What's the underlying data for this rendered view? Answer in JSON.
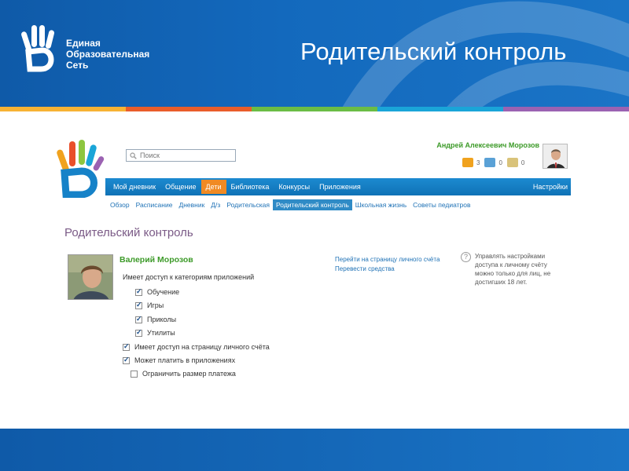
{
  "brand": {
    "logo_line1": "Единая",
    "logo_line2": "Образовательная",
    "logo_line3": "Сеть"
  },
  "slide_title": "Родительский контроль",
  "colors": {
    "banner": "#1369bd",
    "accent_orange": "#f08a24",
    "nav_blue": "#1682c8",
    "green_text": "#3c9a28",
    "stripe": [
      "#f7b234",
      "#e95d2a",
      "#6bbd45",
      "#1aa5d8",
      "#9b62b2"
    ]
  },
  "search": {
    "placeholder": "Поиск"
  },
  "user": {
    "name": "Андрей Алексеевич Морозов",
    "counters": [
      {
        "icon": "mail-icon",
        "value": "3"
      },
      {
        "icon": "friends-icon",
        "value": "0"
      },
      {
        "icon": "requests-icon",
        "value": "0"
      }
    ]
  },
  "nav": {
    "items": [
      "Мой дневник",
      "Общение",
      "Дети",
      "Библиотека",
      "Конкурсы",
      "Приложения"
    ],
    "active": "Дети",
    "settings": "Настройки"
  },
  "subnav": {
    "items": [
      "Обзор",
      "Расписание",
      "Дневник",
      "Д/з",
      "Родительская",
      "Родительский контроль",
      "Школьная жизнь",
      "Советы педиатров"
    ],
    "active": "Родительский контроль"
  },
  "page_title": "Родительский контроль",
  "child": {
    "name": "Валерий Морозов",
    "permissions_heading": "Имеет доступ к категориям приложений",
    "categories": [
      {
        "label": "Обучение",
        "checked": true
      },
      {
        "label": "Игры",
        "checked": true
      },
      {
        "label": "Приколы",
        "checked": true
      },
      {
        "label": "Утилиты",
        "checked": true
      }
    ],
    "options": [
      {
        "label": "Имеет доступ на страницу личного счёта",
        "checked": true
      },
      {
        "label": "Может платить в приложениях",
        "checked": true
      },
      {
        "label": "Ограничить размер платежа",
        "checked": false
      }
    ]
  },
  "links": {
    "go_to_account": "Перейти на страницу личного счёта",
    "transfer_funds": "Перевести средства"
  },
  "help": {
    "icon": "?",
    "text": "Управлять настройками доступа к личному счёту можно только для лиц, не достигших 18 лет."
  }
}
